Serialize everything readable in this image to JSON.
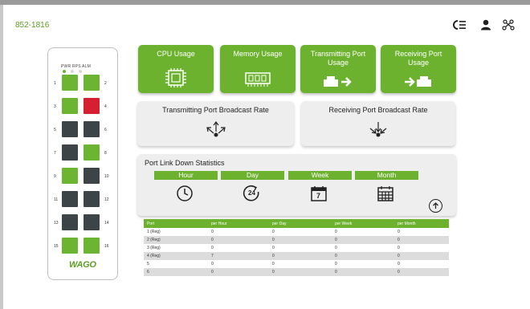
{
  "header": {
    "device_id": "852-1816",
    "icons": [
      "list-icon",
      "user-icon",
      "network-icon"
    ]
  },
  "device": {
    "led_labels": "PWR RPS ALM",
    "brand": "WAGO",
    "ports": [
      {
        "num": "1",
        "state": "green"
      },
      {
        "num": "2",
        "state": "green"
      },
      {
        "num": "3",
        "state": "green"
      },
      {
        "num": "4",
        "state": "red"
      },
      {
        "num": "5",
        "state": "dark"
      },
      {
        "num": "6",
        "state": "dark"
      },
      {
        "num": "7",
        "state": "dark"
      },
      {
        "num": "8",
        "state": "green"
      },
      {
        "num": "9",
        "state": "green"
      },
      {
        "num": "10",
        "state": "dark"
      },
      {
        "num": "11",
        "state": "dark"
      },
      {
        "num": "12",
        "state": "dark"
      },
      {
        "num": "13",
        "state": "dark"
      },
      {
        "num": "14",
        "state": "dark"
      },
      {
        "num": "15",
        "state": "green"
      },
      {
        "num": "16",
        "state": "green"
      }
    ]
  },
  "tiles": {
    "cpu": "CPU Usage",
    "memory": "Memory Usage",
    "tx": "Transmitting Port Usage",
    "rx": "Receiving Port Usage"
  },
  "broadcast": {
    "tx": "Transmitting Port Broadcast Rate",
    "rx": "Receiving Port Broadcast Rate"
  },
  "stats": {
    "title": "Port Link Down Statistics",
    "periods": [
      "Hour",
      "Day",
      "Week",
      "Month"
    ],
    "week_number": "7",
    "day_number": "24"
  },
  "table": {
    "headers": [
      "Port",
      "per Hour",
      "per Day",
      "per Week",
      "per Month"
    ],
    "rows": [
      [
        "1 (Reg)",
        "0",
        "0",
        "0",
        "0"
      ],
      [
        "2 (Reg)",
        "0",
        "0",
        "0",
        "0"
      ],
      [
        "3 (Reg)",
        "0",
        "0",
        "0",
        "0"
      ],
      [
        "4 (Reg)",
        "7",
        "0",
        "0",
        "0"
      ],
      [
        "5",
        "0",
        "0",
        "0",
        "0"
      ],
      [
        "6",
        "0",
        "0",
        "0",
        "0"
      ]
    ]
  },
  "colors": {
    "accent": "#6db22f",
    "port_error": "#d62032",
    "port_inactive": "#3c4448"
  }
}
